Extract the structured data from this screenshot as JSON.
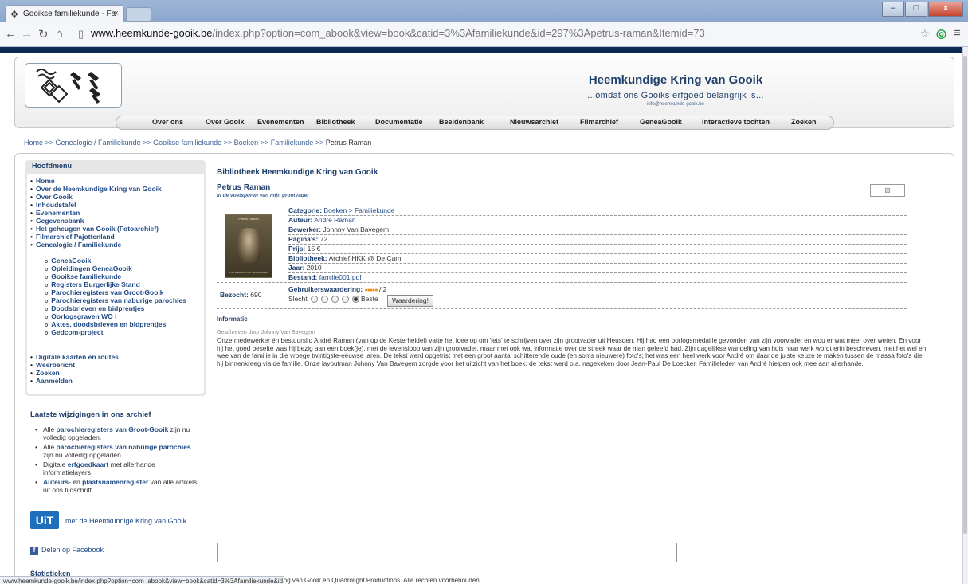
{
  "browser": {
    "tab_title": "Gooikse familiekunde - Fa",
    "tab_close": "×",
    "url_host": "www.heemkunde-gooik.be",
    "url_path": "/index.php?option=com_abook&view=book&catid=3%3Afamiliekunde&id=297%3Apetrus-raman&Itemid=73"
  },
  "site": {
    "title": "Heemkundige Kring van Gooik",
    "subtitle": "...omdat ons Gooiks erfgoed belangrijk is...",
    "email": "info@heemkunde-gooik.be"
  },
  "mainnav": [
    "Over ons",
    "Over Gooik",
    "Evenementen",
    "Bibliotheek",
    "Documentatie",
    "Beeldenbank",
    "Nieuwsarchief",
    "Filmarchief",
    "GeneaGooik",
    "Interactieve tochten",
    "Zoeken"
  ],
  "breadcrumb": {
    "links": "Home >> Genealogie / Familiekunde >> Gooikse familiekunde >> Boeken >> Familiekunde >> ",
    "current": "Petrus Raman"
  },
  "sidebar": {
    "title": "Hoofdmenu",
    "items": [
      "Home",
      "Over de Heemkundige Kring van Gooik",
      "Over Gooik",
      "Inhoudstafel",
      "Evenementen",
      "Gegevensbank",
      "Het geheugen van Gooik (Fotoarchief)",
      "Filmarchief Pajottenland",
      "Genealogie / Familiekunde"
    ],
    "subitems": [
      "GeneaGooik",
      "Opleidingen GeneaGooik",
      "Gooikse familiekunde",
      "Registers Burgerlijke Stand",
      "Parochieregisters van Groot-Gooik",
      "Parochieregisters van naburige parochies",
      "Doodsbrieven en bidprentjes",
      "Oorlogsgraven WO I",
      "Aktes, doodsbrieven en bidprentjes",
      "Gedcom-project"
    ],
    "items2": [
      "Digitale kaarten en routes",
      "Weerbericht",
      "Zoeken",
      "Aanmelden"
    ]
  },
  "recent": {
    "title": "Laatste wijzigingen in ons archief",
    "r1_pre": "Alle ",
    "r1_b": "parochieregisters van Groot-Gooik",
    "r1_post": " zijn nu volledig opgeladen.",
    "r2_pre": "Alle ",
    "r2_b": "parochieregisters van naburige parochies",
    "r2_post": " zijn nu volledig opgeladen.",
    "r3_pre": "Digitale ",
    "r3_b": "erfgoedkaart",
    "r3_post": " met allerhande informatielayers",
    "r4_b1": "Auteurs",
    "r4_mid": "- en ",
    "r4_b2": "plaatsnamenregister",
    "r4_post": " van alle artikels uit ons tijdschrift"
  },
  "uit": {
    "logo": "UiT",
    "text": "met de Heemkundige Kring van Gooik"
  },
  "facebook": {
    "icon": "f",
    "text": "Delen op Facebook"
  },
  "stats_title": "Statistieken",
  "book": {
    "library_title": "Bibliotheek Heemkundige Kring van Gooik",
    "title": "Petrus Raman",
    "subtitle": "In de voetsporen van mijn grootvader",
    "cover_title": "Petrus Raman",
    "cover_footer": "In de voetsporen van mijn grootvader",
    "details": [
      {
        "label": "Categorie:",
        "value": "Boeken > Familiekunde",
        "link": true
      },
      {
        "label": "Auteur:",
        "value": "André Raman",
        "link": true
      },
      {
        "label": "Bewerker:",
        "value": "Johnny Van Bavegem",
        "link": false
      },
      {
        "label": "Pagina's:",
        "value": "72",
        "link": false
      },
      {
        "label": "Prijs:",
        "value": "15 €",
        "link": false
      },
      {
        "label": "Bibliotheek:",
        "value": "Archief HKK @ De Cam",
        "link": false
      },
      {
        "label": "Jaar:",
        "value": "2010",
        "link": false
      },
      {
        "label": "Bestand:",
        "value": "familie001.pdf",
        "link": true
      }
    ],
    "visits_label": "Bezocht:",
    "visits": "690",
    "rating_label": "Gebruikerswaardering:",
    "rating_dots": "●●●●●",
    "rating_count": "/ 2",
    "rating_bad": "Slecht",
    "rating_good": "Beste",
    "vote_button": "Waardering!",
    "info_title": "Informatie",
    "byline": "Geschreven door Johnny Van Bavegem",
    "body": "Onze medewerker én bestuurslid André Raman (van op de Kesterheidel) vatte het idee op om 'iets' te schrijven over zijn grootvader uit Heusden. Hij had een oorlogsmedaille gevonden van zijn voorvader en wou er wat meer over weten. En voor hij het goed besefte was hij bezig aan een boek(je), met de levensloop van zijn grootvader, maar met ook wat informatie over de streek waar de man geleefd had. Zijn dagelijkse wandeling van huis naar werk wordt erin beschreven, met het wel en wee van de familie in die vroege twintigste-eeuwse jaren. De tekst werd opgefrist met een groot aantal schitterende oude (en soms nieuwere) foto's; het was een heel werk voor André om daar de juiste keuze te maken tussen de massa foto's die hij binnenkreeg via de familie. Onze layoutman Johnny Van Bavegem zorgde voor het uitzicht van het boek, de tekst werd o.a. nagekeken door Jean-Paul De Loecker. Familieleden van André hielpen ook mee aan allerhande."
  },
  "footer": "ing van Gooik en Quadrolight Productions. Alle rechten voorbehouden.",
  "status_url": "www.heemkunde-gooik.be/index.php?option=com_abook&view=book&catid=3%3Afamiliekunde&id..."
}
